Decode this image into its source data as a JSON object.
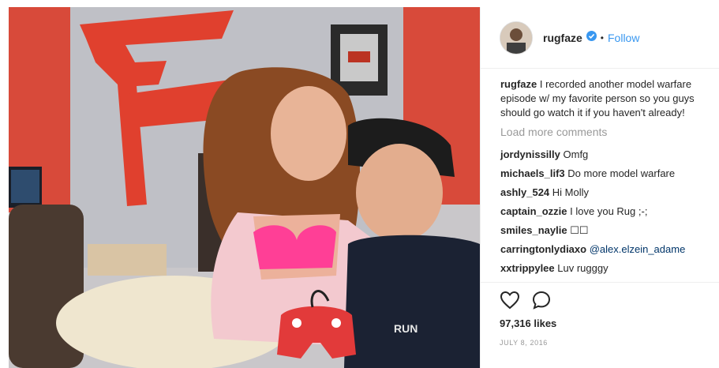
{
  "post": {
    "username": "rugfaze",
    "separator": "•",
    "follow_label": "Follow",
    "caption_user": "rugfaze",
    "caption_text": "I recorded another model warfare episode w/ my favorite person so you guys should go watch it if you haven't already!",
    "load_more_label": "Load more comments",
    "comments": [
      {
        "user": "jordynissilly",
        "text": "Omfg"
      },
      {
        "user": "michaels_lif3",
        "text": "Do more model warfare"
      },
      {
        "user": "ashly_524",
        "text": "Hi Molly"
      },
      {
        "user": "captain_ozzie",
        "text": "I love you Rug ;-;"
      },
      {
        "user": "smiles_naylie",
        "text": "☐☐"
      },
      {
        "user": "carringtonlydiaxo",
        "text": "@alex.elzein_adame"
      },
      {
        "user": "xxtrippylee",
        "text": "Luv rugggy"
      }
    ],
    "likes": "97,316 likes",
    "date": "JULY 8, 2016",
    "photo_logo_text": "F",
    "shirt_text": "RUN"
  },
  "colors": {
    "accent_blue": "#3897f0",
    "wall_red": "#e0402e",
    "bra_pink": "#ff3f96"
  },
  "icons": {
    "like": "heart-icon",
    "comment": "comment-icon",
    "verified": "verified-badge-icon"
  }
}
